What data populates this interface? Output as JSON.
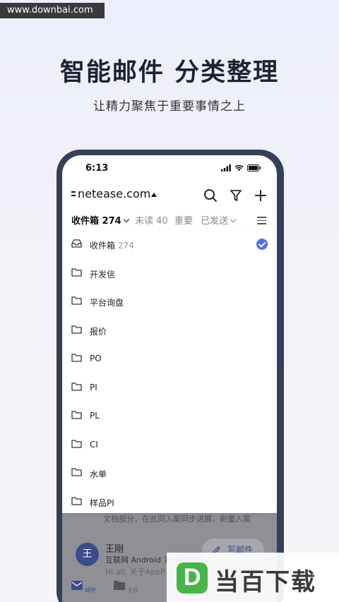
{
  "watermark": "www.downbai.com",
  "headline": "智能邮件  分类整理",
  "subline": "让精力聚焦于重要事情之上",
  "status_bar": {
    "time": "6:13"
  },
  "account": {
    "name": "netease.com"
  },
  "tabs": [
    {
      "label": "收件箱 274"
    },
    {
      "label": "未读 40"
    },
    {
      "label": "重要"
    },
    {
      "label": "已发送"
    }
  ],
  "folders": [
    {
      "label": "收件箱",
      "count": "274",
      "icon": "inbox-icon",
      "selected": true
    },
    {
      "label": "开发信",
      "count": "",
      "icon": "folder-icon"
    },
    {
      "label": "平台询盘",
      "count": "",
      "icon": "folder-icon"
    },
    {
      "label": "报价",
      "count": "",
      "icon": "folder-icon"
    },
    {
      "label": "PO",
      "count": "",
      "icon": "folder-icon"
    },
    {
      "label": "PI",
      "count": "",
      "icon": "folder-icon"
    },
    {
      "label": "PL",
      "count": "",
      "icon": "folder-icon"
    },
    {
      "label": "CI",
      "count": "",
      "icon": "folder-icon"
    },
    {
      "label": "水单",
      "count": "",
      "icon": "folder-icon"
    },
    {
      "label": "样品PI",
      "count": "",
      "icon": "folder-icon"
    }
  ],
  "background_mail": {
    "snippet": "文档部分，在此同入案同步进展，剩量入案",
    "avatar_letter": "王",
    "sender": "王刚",
    "subject": "互联网 Android 7.0 在度周",
    "preview": "Hi all, 关于AppP"
  },
  "write_button": "写邮件",
  "bottom_nav": [
    {
      "label": "邮件"
    },
    {
      "label": "文件"
    }
  ],
  "logo": {
    "mark": "D",
    "text": "当百下载"
  },
  "colors": {
    "accent": "#4c6ef5",
    "phone_frame": "#34405a",
    "logo_green": "#48b548"
  }
}
